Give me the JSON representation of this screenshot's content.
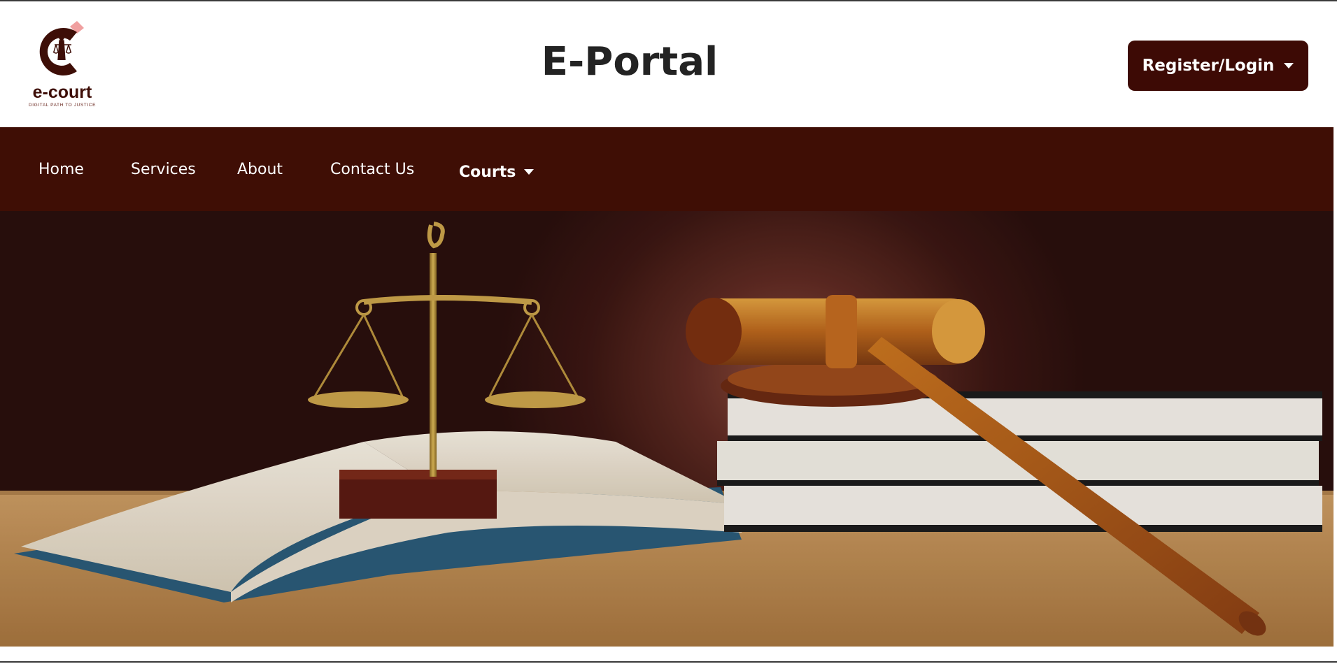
{
  "brand": {
    "logo_word": "e-court",
    "logo_tagline": "DIGITAL PATH TO JUSTICE",
    "colors": {
      "primary": "#3f0e05",
      "accent": "#e88a8a"
    }
  },
  "header": {
    "title": "E-Portal",
    "auth_button": {
      "label": "Register/Login",
      "icon": "caret-down-icon"
    }
  },
  "nav": {
    "items": [
      {
        "label": "Home"
      },
      {
        "label": "Services"
      },
      {
        "label": "About"
      },
      {
        "label": "Contact Us"
      }
    ],
    "courts": {
      "label": "Courts",
      "icon": "caret-down-icon"
    }
  },
  "hero": {
    "image": "scales-of-justice-gavel-and-law-books"
  }
}
